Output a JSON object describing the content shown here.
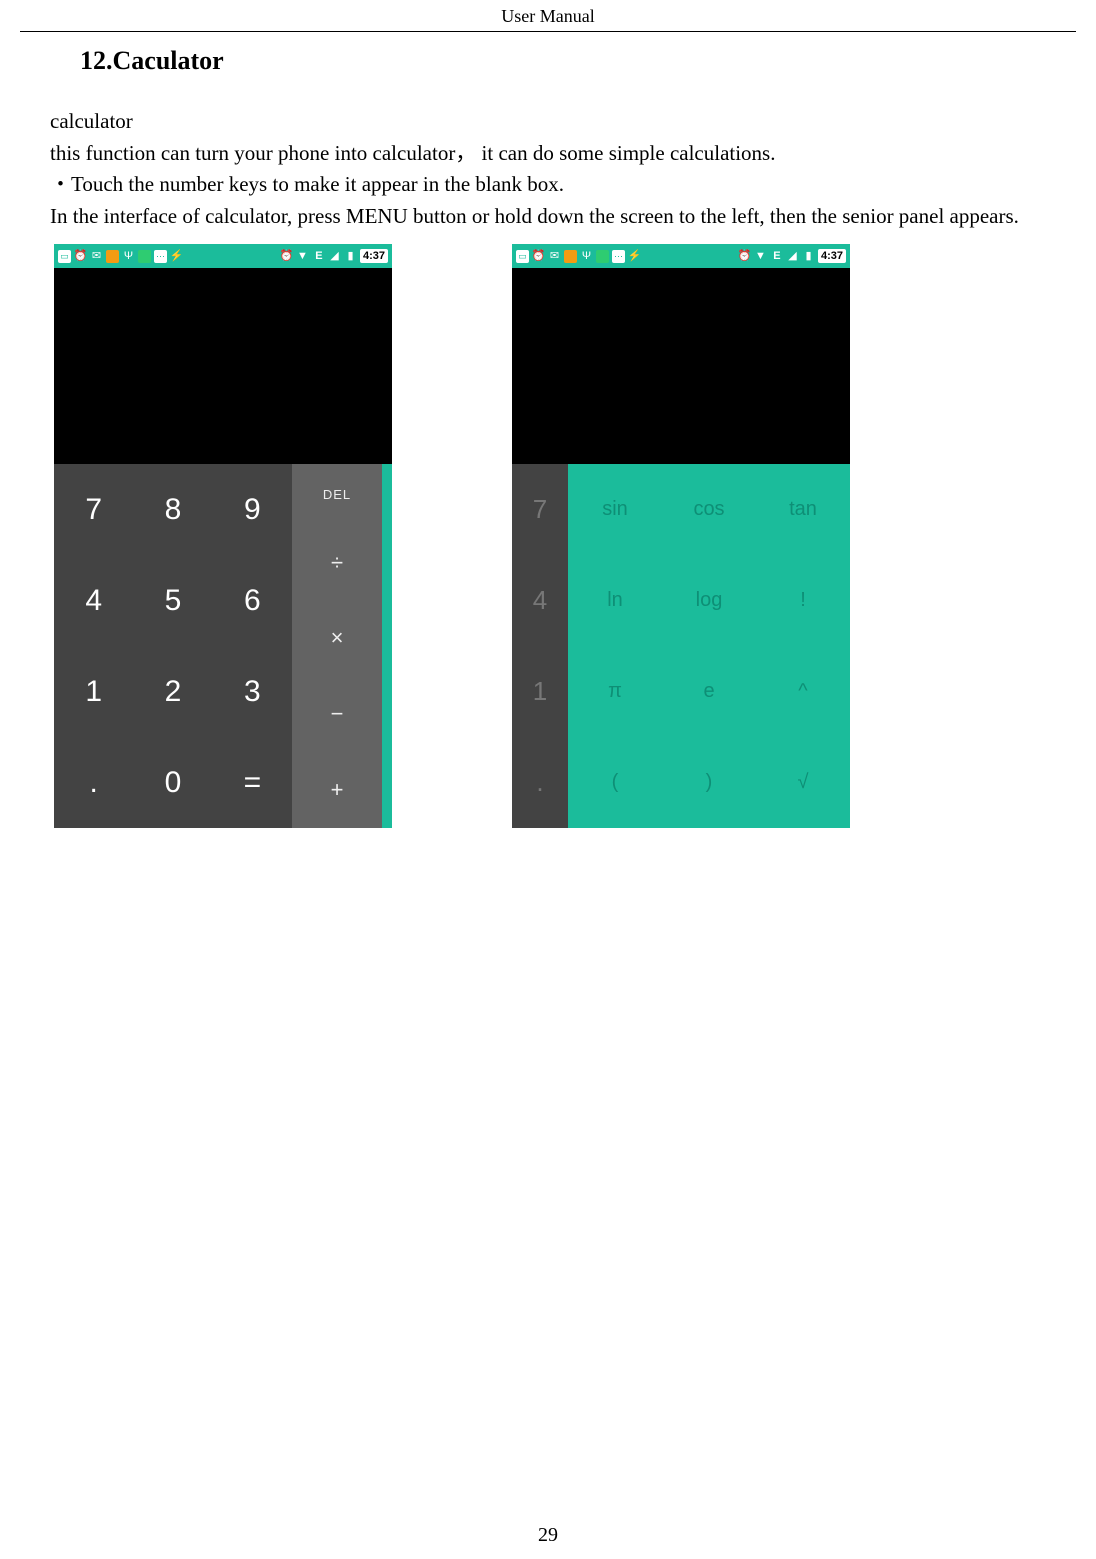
{
  "header": "User    Manual",
  "section_title": "12.Caculator",
  "p1": "calculator",
  "p2": "this function can turn your phone into calculator，  it can do some simple calculations.",
  "p3": "・Touch the number keys to make it appear in the blank box.",
  "p4": "In the interface of calculator, press MENU button or hold down the screen to the left, then the senior panel appears.",
  "status": {
    "time": "4:37",
    "edge": "E"
  },
  "basic": {
    "nums": [
      "7",
      "8",
      "9",
      "4",
      "5",
      "6",
      "1",
      "2",
      "3",
      ".",
      "0",
      "="
    ],
    "ops": [
      "DEL",
      "÷",
      "×",
      "−",
      "+"
    ]
  },
  "adv": {
    "peek": [
      "7",
      "4",
      "1",
      "."
    ],
    "keys": [
      "sin",
      "cos",
      "tan",
      "ln",
      "log",
      "!",
      "π",
      "e",
      "^",
      "(",
      ")",
      "√"
    ]
  },
  "page_number": "29"
}
